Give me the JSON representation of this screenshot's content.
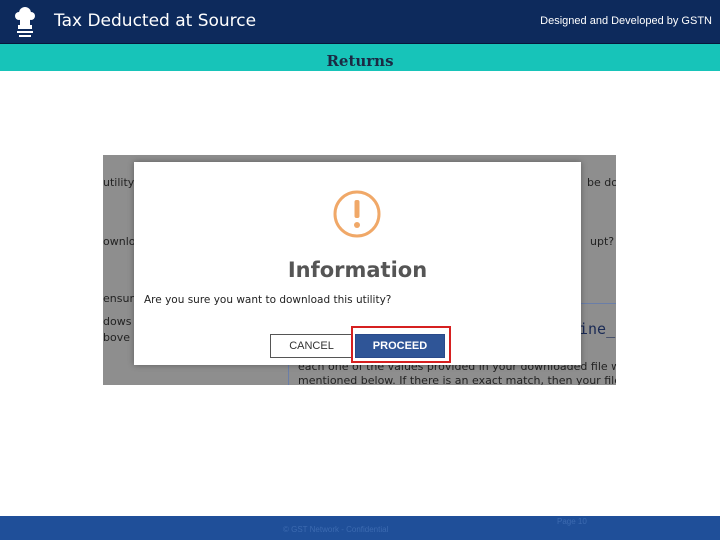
{
  "header": {
    "title": "Tax Deducted at Source",
    "credit": "Designed and Developed by GSTN"
  },
  "subheader": {
    "title": "Returns"
  },
  "screenshot_bg": {
    "fragments": [
      "utility",
      "be do",
      "ownlos",
      "upt? Cl",
      "ensur",
      "dows t",
      "bove",
      "ine_U"
    ],
    "line1": "each one of the values provided in your downloaded file wi",
    "line2": "mentioned below. If there is an exact match, then your file i"
  },
  "modal": {
    "title": "Information",
    "message": "Are you sure you want to download this utility?",
    "cancel_label": "CANCEL",
    "proceed_label": "PROCEED"
  },
  "footer": {
    "text": "© GST Network - Confidential",
    "page": "Page 10"
  },
  "colors": {
    "header_bg": "#0d2a5c",
    "subbar_bg": "#17c4b9",
    "footer_bg": "#1f4f99",
    "icon_orange": "#f0a868",
    "proceed_bg": "#2f5597",
    "highlight_red": "#d62020"
  }
}
